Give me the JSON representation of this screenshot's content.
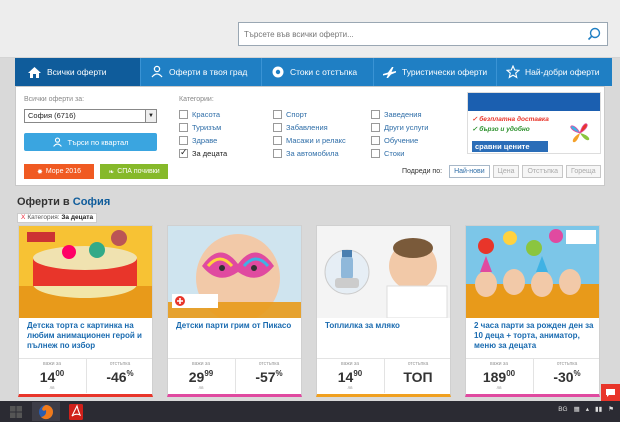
{
  "search": {
    "placeholder": "Търсете във всички оферти..."
  },
  "nav": [
    {
      "label": "Всички оферти",
      "icon": "home-icon"
    },
    {
      "label": "Оферти в твоя град",
      "icon": "location-person-icon"
    },
    {
      "label": "Стоки с отстъпка",
      "icon": "gear-badge-icon"
    },
    {
      "label": "Туристически оферти",
      "icon": "plane-icon"
    },
    {
      "label": "Най-добри оферти",
      "icon": "star-badge-icon"
    }
  ],
  "filters": {
    "all_offers_label": "Всички оферти за:",
    "city": "София (6716)",
    "neighborhood_button": "Търси по квартал",
    "sea_button": "Море 2016",
    "spa_button": "СПА почивки",
    "categories_label": "Категории:",
    "categories": [
      {
        "label": "Красота",
        "checked": false
      },
      {
        "label": "Туризъм",
        "checked": false
      },
      {
        "label": "Здраве",
        "checked": false
      },
      {
        "label": "За децата",
        "checked": true
      },
      {
        "label": "Спорт",
        "checked": false
      },
      {
        "label": "Забавления",
        "checked": false
      },
      {
        "label": "Масажи и релакс",
        "checked": false
      },
      {
        "label": "За автомобила",
        "checked": false
      },
      {
        "label": "Заведения",
        "checked": false
      },
      {
        "label": "Други услуги",
        "checked": false
      },
      {
        "label": "Обучение",
        "checked": false
      },
      {
        "label": "Стоки",
        "checked": false
      }
    ],
    "sort_label": "Подреди по:",
    "sort_options": [
      "Най-нови",
      "Цена",
      "Отстъпка",
      "Гореща"
    ]
  },
  "ad": {
    "line1": "✓ безплатна доставка",
    "line2": "✓ бързо и удобно",
    "compare": "сравни цените",
    "color_line1": "#e8352a",
    "color_line2": "#2a8f2a"
  },
  "section": {
    "title_prefix": "Оферти в ",
    "city": "София",
    "tag_x": "X",
    "tag_prefix": "Категория: ",
    "tag_value": "За децата"
  },
  "cards": [
    {
      "title": "Детска торта с картинка на любим анимационен герой и пълнеж по избор",
      "price_label": "важи за",
      "price_int": "14",
      "price_dec": "00",
      "unit": "лв",
      "discount_label": "отстъпка",
      "discount": "-46",
      "discount_suffix": "%",
      "accent": "#e8352a"
    },
    {
      "title": "Детски парти грим от Пикасо",
      "price_label": "важи за",
      "price_int": "29",
      "price_dec": "99",
      "unit": "лв",
      "discount_label": "отстъпка",
      "discount": "-57",
      "discount_suffix": "%",
      "accent": "#e04aa0"
    },
    {
      "title": "Топлилка за мляко",
      "price_label": "важи за",
      "price_int": "14",
      "price_dec": "90",
      "unit": "лв",
      "discount_label": "отстъпка",
      "discount": "ТОП",
      "discount_suffix": "",
      "accent": "#f0a020"
    },
    {
      "title": "2 часа парти за рожден ден за 10 деца + торта, аниматор, меню за децата",
      "price_label": "важи за",
      "price_int": "189",
      "price_dec": "00",
      "unit": "лв",
      "discount_label": "отстъпка",
      "discount": "-30",
      "discount_suffix": "%",
      "accent": "#e04aa0"
    }
  ],
  "taskbar": {
    "lang": "BG"
  }
}
